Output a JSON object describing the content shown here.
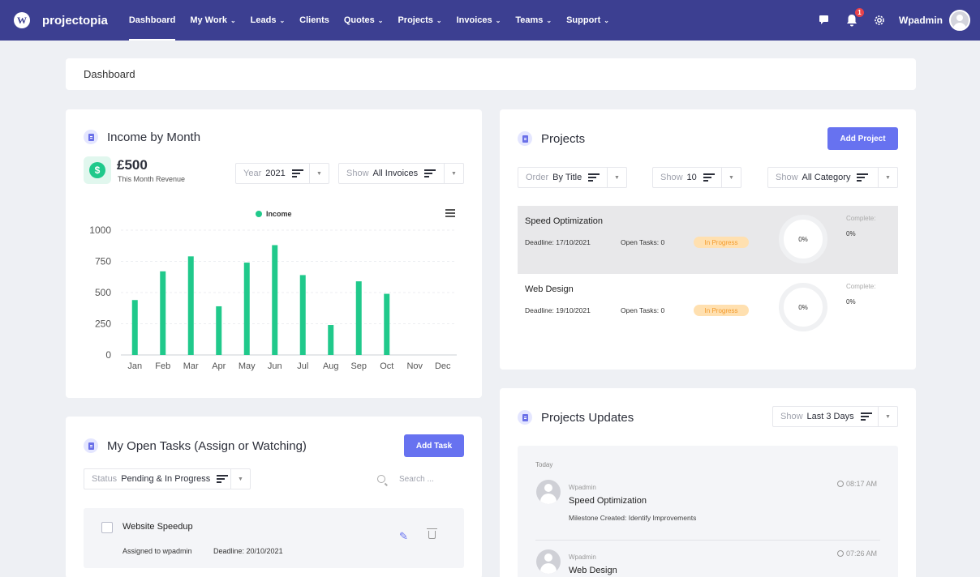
{
  "nav": {
    "brand": "projectopia",
    "menu": [
      {
        "label": "Dashboard",
        "has_dropdown": false,
        "active": true
      },
      {
        "label": "My Work",
        "has_dropdown": true
      },
      {
        "label": "Leads",
        "has_dropdown": true
      },
      {
        "label": "Clients",
        "has_dropdown": false
      },
      {
        "label": "Quotes",
        "has_dropdown": true
      },
      {
        "label": "Projects",
        "has_dropdown": true
      },
      {
        "label": "Invoices",
        "has_dropdown": true
      },
      {
        "label": "Teams",
        "has_dropdown": true
      },
      {
        "label": "Support",
        "has_dropdown": true
      }
    ],
    "notification_count": "1",
    "username": "Wpadmin",
    "icons": [
      "wordpress-icon",
      "chat-icon",
      "bell-icon",
      "gear-icon",
      "user-avatar"
    ]
  },
  "breadcrumb": "Dashboard",
  "income": {
    "title": "Income by Month",
    "revenue_value": "£500",
    "revenue_label": "This Month Revenue",
    "year_filter": {
      "label": "Year",
      "value": "2021"
    },
    "show_filter": {
      "label": "Show",
      "value": "All Invoices"
    }
  },
  "chart_data": {
    "type": "bar",
    "categories": [
      "Jan",
      "Feb",
      "Mar",
      "Apr",
      "May",
      "Jun",
      "Jul",
      "Aug",
      "Sep",
      "Oct",
      "Nov",
      "Dec"
    ],
    "series": [
      {
        "name": "Income",
        "values": [
          440,
          670,
          790,
          390,
          740,
          880,
          640,
          240,
          590,
          490,
          0,
          0
        ]
      }
    ],
    "ylim": [
      0,
      1000
    ],
    "yticks": [
      0,
      250,
      500,
      750,
      1000
    ],
    "legend": "top-center",
    "grid": true,
    "color": "#20c98b"
  },
  "tasks": {
    "title": "My Open Tasks (Assign or Watching)",
    "add_label": "Add Task",
    "status_filter": {
      "label": "Status",
      "value": "Pending & In Progress"
    },
    "search_placeholder": "Search ...",
    "items": [
      {
        "name": "Website Speedup",
        "assigned": "Assigned to wpadmin",
        "deadline": "Deadline: 20/10/2021"
      }
    ]
  },
  "projects": {
    "title": "Projects",
    "add_label": "Add Project",
    "order_filter": {
      "label": "Order",
      "value": "By Title"
    },
    "show_filter": {
      "label": "Show",
      "value": "10"
    },
    "category_filter": {
      "label": "Show",
      "value": "All Category"
    },
    "items": [
      {
        "name": "Speed Optimization",
        "deadline": "Deadline:  17/10/2021",
        "open_tasks": "Open Tasks:  0",
        "status": "In Progress",
        "progress_label": "0%",
        "complete_label": "Complete:",
        "complete_value": "0%"
      },
      {
        "name": "Web Design",
        "deadline": "Deadline:  19/10/2021",
        "open_tasks": "Open Tasks:  0",
        "status": "In Progress",
        "progress_label": "0%",
        "complete_label": "Complete:",
        "complete_value": "0%"
      }
    ]
  },
  "updates": {
    "title": "Projects Updates",
    "show_filter": {
      "label": "Show",
      "value": "Last 3 Days"
    },
    "day": "Today",
    "items": [
      {
        "user": "Wpadmin",
        "title": "Speed Optimization",
        "desc": "Milestone Created: Identify Improvements",
        "time": "08:17 AM"
      },
      {
        "user": "Wpadmin",
        "title": "Web Design",
        "desc": "",
        "time": "07:26 AM"
      }
    ]
  }
}
